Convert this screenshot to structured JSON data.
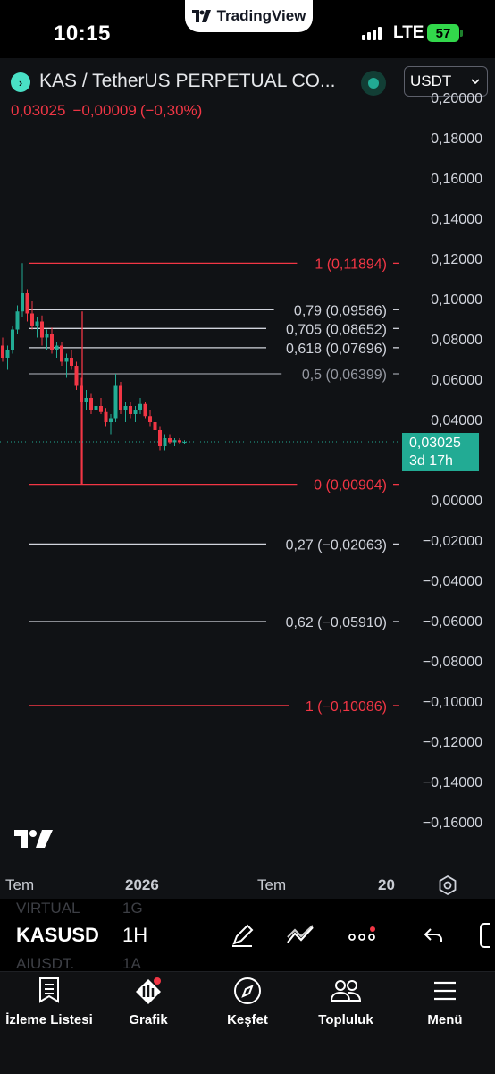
{
  "status_bar": {
    "time": "10:15",
    "app_name": "TradingView",
    "network": "LTE",
    "battery": "57"
  },
  "header": {
    "symbol_title": "KAS / TetherUS PERPETUAL CO...",
    "currency": "USDT",
    "price": "0,03025",
    "change": "−0,00009",
    "change_pct": "(−0,30%)"
  },
  "chart_data": {
    "type": "candlestick",
    "timeframe": "1H",
    "yaxis_ticks": [
      "0,20000",
      "0,18000",
      "0,16000",
      "0,14000",
      "0,12000",
      "0,10000",
      "0,08000",
      "0,06000",
      "0,04000",
      "0,00000",
      "−0,02000",
      "−0,04000",
      "−0,06000",
      "−0,08000",
      "−0,10000",
      "−0,12000",
      "−0,14000",
      "−0,16000"
    ],
    "xaxis_ticks": [
      "Tem",
      "2026",
      "Tem",
      "20"
    ],
    "last_price": {
      "value": "0,03025",
      "countdown": "3d 17h"
    },
    "fib_levels": [
      {
        "label": "1 (0,11894)",
        "ratio": 1,
        "price": 0.11894,
        "color": "#f23645"
      },
      {
        "label": "0,79 (0,09586)",
        "ratio": 0.79,
        "price": 0.09586,
        "color": "#d1d4dc"
      },
      {
        "label": "0,705 (0,08652)",
        "ratio": 0.705,
        "price": 0.08652,
        "color": "#d1d4dc"
      },
      {
        "label": "0,618 (0,07696)",
        "ratio": 0.618,
        "price": 0.07696,
        "color": "#d1d4dc"
      },
      {
        "label": "0,5 (0,06399)",
        "ratio": 0.5,
        "price": 0.06399,
        "color": "#9598a1"
      },
      {
        "label": "0 (0,00904)",
        "ratio": 0,
        "price": 0.00904,
        "color": "#f23645"
      },
      {
        "label": "0,27 (−0,02063)",
        "ratio": -0.27,
        "price": -0.02063,
        "color": "#d1d4dc"
      },
      {
        "label": "0,62 (−0,05910)",
        "ratio": -0.62,
        "price": -0.0591,
        "color": "#d1d4dc"
      },
      {
        "label": "1 (−0,10086)",
        "ratio": -1,
        "price": -0.10086,
        "color": "#f23645"
      }
    ],
    "candles": [
      [
        0.078,
        0.082,
        0.07,
        0.072
      ],
      [
        0.072,
        0.078,
        0.066,
        0.076
      ],
      [
        0.076,
        0.088,
        0.074,
        0.086
      ],
      [
        0.086,
        0.098,
        0.084,
        0.095
      ],
      [
        0.095,
        0.119,
        0.092,
        0.104
      ],
      [
        0.104,
        0.106,
        0.09,
        0.094
      ],
      [
        0.094,
        0.1,
        0.086,
        0.088
      ],
      [
        0.088,
        0.092,
        0.082,
        0.09
      ],
      [
        0.09,
        0.093,
        0.078,
        0.082
      ],
      [
        0.082,
        0.086,
        0.076,
        0.084
      ],
      [
        0.084,
        0.087,
        0.074,
        0.076
      ],
      [
        0.076,
        0.08,
        0.072,
        0.078
      ],
      [
        0.078,
        0.08,
        0.068,
        0.07
      ],
      [
        0.07,
        0.074,
        0.062,
        0.072
      ],
      [
        0.072,
        0.076,
        0.066,
        0.068
      ],
      [
        0.068,
        0.07,
        0.056,
        0.058
      ],
      [
        0.058,
        0.062,
        0.009,
        0.05
      ],
      [
        0.05,
        0.056,
        0.046,
        0.052
      ],
      [
        0.052,
        0.054,
        0.044,
        0.046
      ],
      [
        0.046,
        0.05,
        0.04,
        0.048
      ],
      [
        0.048,
        0.052,
        0.044,
        0.045
      ],
      [
        0.045,
        0.047,
        0.038,
        0.04
      ],
      [
        0.04,
        0.044,
        0.034,
        0.042
      ],
      [
        0.042,
        0.064,
        0.04,
        0.058
      ],
      [
        0.058,
        0.06,
        0.044,
        0.046
      ],
      [
        0.046,
        0.05,
        0.04,
        0.048
      ],
      [
        0.048,
        0.05,
        0.042,
        0.044
      ],
      [
        0.044,
        0.048,
        0.04,
        0.046
      ],
      [
        0.046,
        0.052,
        0.044,
        0.049
      ],
      [
        0.049,
        0.05,
        0.042,
        0.043
      ],
      [
        0.043,
        0.046,
        0.038,
        0.04
      ],
      [
        0.04,
        0.044,
        0.034,
        0.036
      ],
      [
        0.036,
        0.038,
        0.026,
        0.028
      ],
      [
        0.028,
        0.034,
        0.026,
        0.032
      ],
      [
        0.032,
        0.034,
        0.029,
        0.03
      ],
      [
        0.03,
        0.032,
        0.028,
        0.031
      ],
      [
        0.031,
        0.032,
        0.029,
        0.03
      ],
      [
        0.03,
        0.031,
        0.029,
        0.0302
      ]
    ]
  },
  "toolbar": {
    "symbol": "KASUSD",
    "interval": "1H",
    "ghost_top": [
      "VIRTUAL",
      "1G"
    ],
    "ghost_bottom": [
      "AIUSDT.",
      "1A"
    ]
  },
  "nav": {
    "items": [
      {
        "label": "İzleme Listesi",
        "icon": "watchlist-icon"
      },
      {
        "label": "Grafik",
        "icon": "chart-icon"
      },
      {
        "label": "Keşfet",
        "icon": "compass-icon"
      },
      {
        "label": "Topluluk",
        "icon": "community-icon"
      },
      {
        "label": "Menü",
        "icon": "menu-icon"
      }
    ]
  }
}
